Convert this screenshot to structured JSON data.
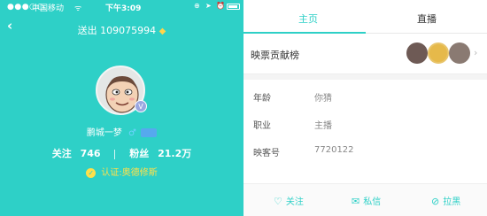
{
  "status": {
    "signal": "●●●○○",
    "carrier": "中国移动",
    "wifi": "ᯤ",
    "time": "下午3:09",
    "lock": "⊕",
    "location": "➤",
    "alarm": "⏰"
  },
  "profile": {
    "back": "‹",
    "sent_text": "送出 109075994",
    "name": "鹏城一梦",
    "gender_symbol": "♂",
    "follow_label": "关注",
    "follow_count": "746",
    "fans_label": "粉丝",
    "fans_count": "21.2万",
    "verify_text": "认证:奥德修斯",
    "verify_check": "✓"
  },
  "tabs": {
    "main": "主页",
    "live": "直播"
  },
  "contrib": {
    "label": "映票贡献榜",
    "chevron": "›"
  },
  "info": [
    {
      "key": "年龄",
      "value": "你猜"
    },
    {
      "key": "职业",
      "value": "主播"
    },
    {
      "key": "映客号",
      "value": "7720122"
    }
  ],
  "bottom": {
    "follow": "关注",
    "message": "私信",
    "block": "拉黑"
  },
  "colors": {
    "accent": "#2ed0c7",
    "verify": "#ffe04a"
  }
}
